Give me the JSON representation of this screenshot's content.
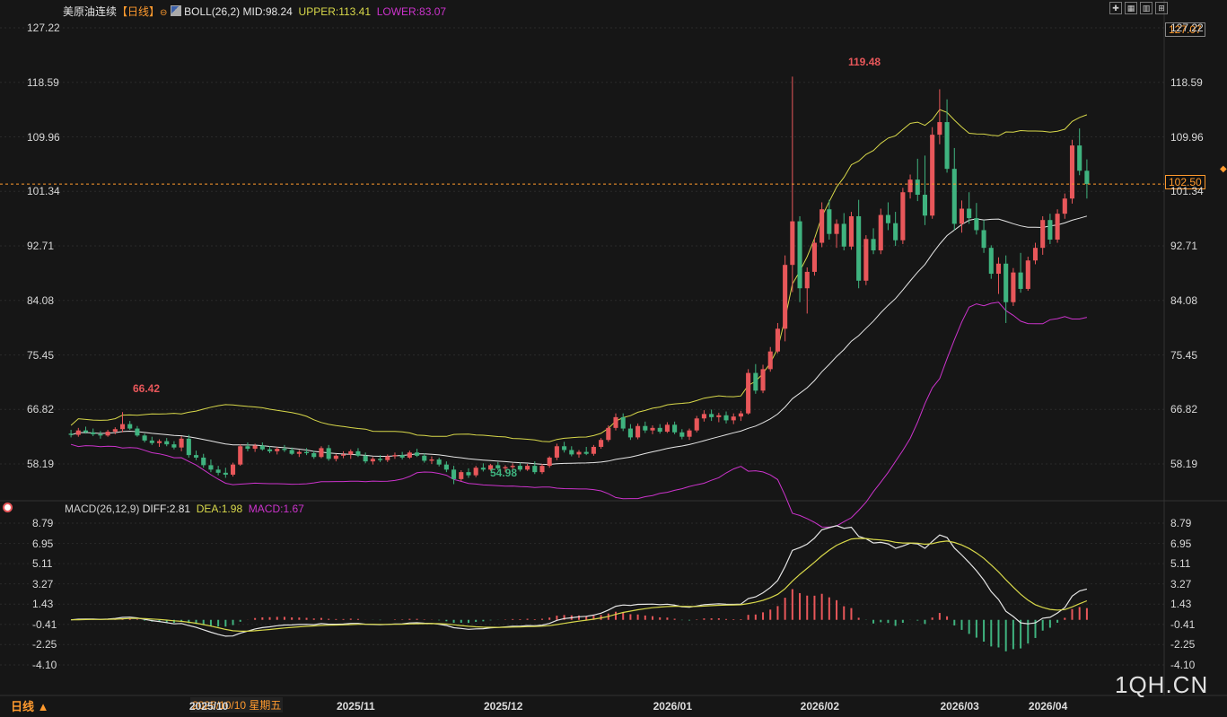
{
  "header": {
    "instrument": "美原油连续",
    "period": "【日线】",
    "boll": {
      "label": "BOLL(26,2)",
      "mid": "MID:98.24",
      "upper": "UPPER:113.41",
      "lower": "LOWER:83.07"
    }
  },
  "macd_header": {
    "label": "MACD(26,12,9)",
    "diff": "DIFF:2.81",
    "dea": "DEA:1.98",
    "macd": "MACD:1.67"
  },
  "toolbar": {
    "icons": [
      "crosshair-icon",
      "grid-icon",
      "candle-icon",
      "zoom-in-icon"
    ]
  },
  "price_axis": [
    "127.22",
    "118.59",
    "109.96",
    "101.34",
    "92.71",
    "84.08",
    "75.45",
    "66.82",
    "58.19"
  ],
  "price_axis_right": [
    "127.22",
    "118.59",
    "109.96",
    "101.34",
    "92.71",
    "84.08",
    "75.45",
    "66.82",
    "58.19"
  ],
  "macd_axis": [
    "8.79",
    "6.95",
    "5.11",
    "3.27",
    "1.43",
    "-0.41",
    "-2.25",
    "-4.10"
  ],
  "last_price": "102.50",
  "cursor_price": "127.07",
  "annotations": {
    "high": "119.48",
    "left_high": "66.42",
    "low": "54.98"
  },
  "x_axis": [
    "2025/10",
    "2025/11",
    "2025/12",
    "2026/01",
    "2026/02",
    "2026/03",
    "2026/04"
  ],
  "cursor_date": "2025/10/10 星期五",
  "period_selector": "日线 ▲",
  "watermark": "1QH.CN",
  "colors": {
    "up": "#e8575a",
    "down": "#3fb37f",
    "upper": "#d8d84a",
    "mid": "#e6e6e6",
    "lower": "#cc33cc",
    "accent": "#ff9a2e"
  },
  "chart_data": {
    "type": "candlestick",
    "series_note": "daily OHLC",
    "ohlc": [
      [
        63.0,
        63.6,
        62.4,
        62.8
      ],
      [
        62.8,
        63.9,
        62.5,
        63.5
      ],
      [
        63.5,
        64.1,
        63.0,
        63.2
      ],
      [
        63.2,
        63.8,
        62.6,
        62.9
      ],
      [
        62.9,
        63.4,
        62.2,
        62.7
      ],
      [
        62.7,
        63.6,
        62.5,
        63.3
      ],
      [
        63.3,
        64.0,
        62.9,
        63.7
      ],
      [
        63.7,
        66.4,
        63.2,
        64.5
      ],
      [
        64.5,
        65.0,
        63.6,
        63.8
      ],
      [
        63.8,
        64.2,
        62.5,
        62.7
      ],
      [
        62.7,
        63.0,
        61.6,
        61.9
      ],
      [
        61.9,
        62.5,
        61.2,
        61.5
      ],
      [
        61.5,
        62.1,
        60.9,
        61.8
      ],
      [
        61.8,
        62.3,
        61.0,
        61.3
      ],
      [
        61.3,
        61.8,
        60.5,
        60.8
      ],
      [
        60.8,
        62.6,
        60.2,
        62.2
      ],
      [
        62.2,
        62.8,
        59.2,
        59.6
      ],
      [
        59.6,
        60.3,
        58.8,
        59.2
      ],
      [
        59.2,
        59.8,
        57.6,
        58.0
      ],
      [
        58.0,
        58.9,
        56.9,
        57.3
      ],
      [
        57.3,
        57.9,
        56.4,
        56.8
      ],
      [
        56.8,
        57.6,
        56.0,
        56.5
      ],
      [
        56.5,
        58.4,
        56.2,
        58.1
      ],
      [
        58.1,
        61.3,
        57.9,
        61.0
      ],
      [
        61.0,
        61.6,
        60.2,
        60.6
      ],
      [
        60.6,
        61.4,
        60.1,
        61.1
      ],
      [
        61.1,
        61.6,
        60.3,
        60.5
      ],
      [
        60.5,
        61.0,
        59.9,
        60.2
      ],
      [
        60.2,
        60.9,
        59.7,
        60.6
      ],
      [
        60.6,
        61.2,
        60.1,
        60.4
      ],
      [
        60.4,
        60.8,
        59.6,
        59.8
      ],
      [
        59.8,
        60.4,
        59.3,
        60.1
      ],
      [
        60.1,
        60.7,
        59.6,
        59.9
      ],
      [
        59.9,
        60.3,
        59.0,
        59.3
      ],
      [
        59.3,
        61.0,
        59.1,
        60.7
      ],
      [
        60.7,
        61.2,
        58.7,
        59.0
      ],
      [
        59.0,
        59.8,
        58.6,
        59.5
      ],
      [
        59.5,
        60.2,
        59.1,
        59.7
      ],
      [
        59.7,
        60.5,
        59.0,
        60.2
      ],
      [
        60.2,
        60.7,
        59.3,
        59.5
      ],
      [
        59.5,
        60.0,
        58.3,
        58.6
      ],
      [
        58.6,
        59.3,
        58.1,
        59.0
      ],
      [
        59.0,
        59.6,
        58.5,
        58.8
      ],
      [
        58.8,
        59.7,
        58.5,
        59.4
      ],
      [
        59.4,
        60.0,
        59.0,
        59.6
      ],
      [
        59.6,
        60.1,
        58.9,
        59.2
      ],
      [
        59.2,
        60.3,
        59.0,
        60.0
      ],
      [
        60.0,
        60.6,
        59.3,
        59.5
      ],
      [
        59.5,
        59.9,
        58.4,
        58.7
      ],
      [
        58.7,
        59.4,
        58.2,
        58.9
      ],
      [
        58.9,
        59.2,
        57.8,
        58.1
      ],
      [
        58.1,
        58.6,
        56.9,
        57.3
      ],
      [
        57.3,
        57.9,
        55.0,
        55.8
      ],
      [
        55.8,
        57.2,
        55.5,
        56.9
      ],
      [
        56.9,
        57.5,
        56.0,
        56.4
      ],
      [
        56.4,
        57.9,
        56.1,
        57.6
      ],
      [
        57.6,
        58.3,
        57.0,
        57.3
      ],
      [
        57.3,
        58.2,
        57.1,
        58.0
      ],
      [
        58.0,
        58.5,
        57.2,
        57.5
      ],
      [
        57.5,
        58.0,
        56.9,
        57.7
      ],
      [
        57.7,
        58.3,
        57.3,
        57.9
      ],
      [
        57.9,
        58.4,
        57.0,
        57.3
      ],
      [
        57.3,
        58.2,
        57.1,
        57.9
      ],
      [
        57.9,
        58.6,
        56.6,
        56.9
      ],
      [
        56.9,
        58.2,
        56.6,
        57.9
      ],
      [
        57.9,
        59.4,
        57.6,
        59.2
      ],
      [
        59.2,
        61.4,
        58.8,
        61.0
      ],
      [
        61.0,
        61.7,
        60.0,
        60.4
      ],
      [
        60.4,
        61.0,
        59.4,
        59.7
      ],
      [
        59.7,
        60.4,
        59.2,
        60.1
      ],
      [
        60.1,
        60.9,
        59.6,
        59.8
      ],
      [
        59.8,
        61.2,
        59.5,
        60.9
      ],
      [
        60.9,
        62.3,
        60.6,
        62.0
      ],
      [
        62.0,
        64.3,
        61.7,
        63.9
      ],
      [
        63.9,
        66.2,
        63.5,
        65.6
      ],
      [
        65.6,
        66.2,
        63.4,
        63.8
      ],
      [
        63.8,
        64.5,
        62.0,
        62.4
      ],
      [
        62.4,
        64.6,
        62.1,
        64.2
      ],
      [
        64.2,
        64.9,
        63.1,
        63.5
      ],
      [
        63.5,
        64.3,
        62.9,
        63.9
      ],
      [
        63.9,
        64.5,
        63.0,
        63.3
      ],
      [
        63.3,
        64.8,
        63.1,
        64.4
      ],
      [
        64.4,
        64.9,
        62.9,
        63.2
      ],
      [
        63.2,
        63.7,
        62.1,
        62.5
      ],
      [
        62.5,
        63.8,
        62.0,
        63.5
      ],
      [
        63.5,
        65.8,
        63.2,
        65.4
      ],
      [
        65.4,
        66.7,
        64.9,
        66.1
      ],
      [
        66.1,
        66.8,
        65.0,
        65.6
      ],
      [
        65.6,
        66.3,
        64.8,
        65.9
      ],
      [
        65.9,
        66.5,
        64.6,
        65.1
      ],
      [
        65.1,
        66.2,
        64.5,
        65.7
      ],
      [
        65.7,
        66.6,
        65.0,
        66.2
      ],
      [
        66.2,
        73.2,
        66.0,
        72.6
      ],
      [
        72.6,
        74.0,
        69.3,
        69.8
      ],
      [
        69.8,
        73.9,
        69.4,
        73.2
      ],
      [
        73.2,
        76.7,
        72.8,
        76.0
      ],
      [
        76.0,
        80.5,
        75.7,
        79.6
      ],
      [
        79.6,
        91.2,
        77.6,
        89.7
      ],
      [
        89.7,
        119.5,
        85.4,
        96.6
      ],
      [
        96.6,
        97.4,
        83.8,
        86.0
      ],
      [
        86.0,
        89.3,
        82.0,
        88.6
      ],
      [
        88.6,
        94.0,
        88.0,
        93.2
      ],
      [
        93.2,
        99.6,
        92.5,
        98.5
      ],
      [
        98.5,
        100.0,
        93.7,
        94.6
      ],
      [
        94.6,
        96.9,
        92.4,
        96.2
      ],
      [
        96.2,
        97.9,
        92.0,
        92.6
      ],
      [
        92.6,
        98.1,
        92.1,
        97.4
      ],
      [
        97.4,
        100.0,
        86.0,
        87.2
      ],
      [
        87.2,
        94.4,
        86.5,
        93.8
      ],
      [
        93.8,
        95.5,
        91.4,
        92.0
      ],
      [
        92.0,
        98.6,
        91.4,
        97.6
      ],
      [
        97.6,
        99.6,
        95.2,
        96.3
      ],
      [
        96.3,
        98.1,
        92.7,
        93.6
      ],
      [
        93.6,
        101.9,
        93.0,
        101.2
      ],
      [
        101.2,
        104.0,
        100.2,
        103.2
      ],
      [
        103.2,
        106.5,
        99.8,
        100.8
      ],
      [
        100.8,
        107.0,
        96.0,
        97.5
      ],
      [
        97.5,
        111.5,
        97.0,
        110.3
      ],
      [
        110.3,
        117.5,
        108.8,
        112.3
      ],
      [
        112.3,
        115.9,
        104.3,
        104.9
      ],
      [
        104.9,
        108.2,
        95.2,
        96.2
      ],
      [
        96.2,
        99.9,
        94.8,
        98.6
      ],
      [
        98.6,
        101.2,
        96.2,
        97.1
      ],
      [
        97.1,
        99.5,
        94.5,
        95.2
      ],
      [
        95.2,
        96.8,
        91.6,
        92.4
      ],
      [
        92.4,
        92.8,
        87.5,
        88.3
      ],
      [
        88.3,
        90.9,
        85.1,
        89.9
      ],
      [
        89.9,
        91.2,
        80.5,
        83.8
      ],
      [
        83.8,
        89.2,
        83.2,
        88.5
      ],
      [
        88.5,
        91.6,
        85.3,
        85.9
      ],
      [
        85.9,
        91.0,
        85.6,
        90.4
      ],
      [
        90.4,
        93.2,
        89.8,
        92.4
      ],
      [
        92.4,
        97.4,
        91.3,
        96.8
      ],
      [
        96.8,
        97.8,
        93.0,
        93.7
      ],
      [
        93.7,
        98.5,
        93.2,
        97.8
      ],
      [
        97.8,
        101.0,
        97.0,
        100.2
      ],
      [
        100.2,
        109.5,
        99.4,
        108.6
      ],
      [
        108.6,
        111.3,
        103.9,
        104.6
      ],
      [
        104.6,
        106.4,
        100.2,
        102.5
      ]
    ],
    "y_range": [
      52.8,
      128.5
    ]
  }
}
